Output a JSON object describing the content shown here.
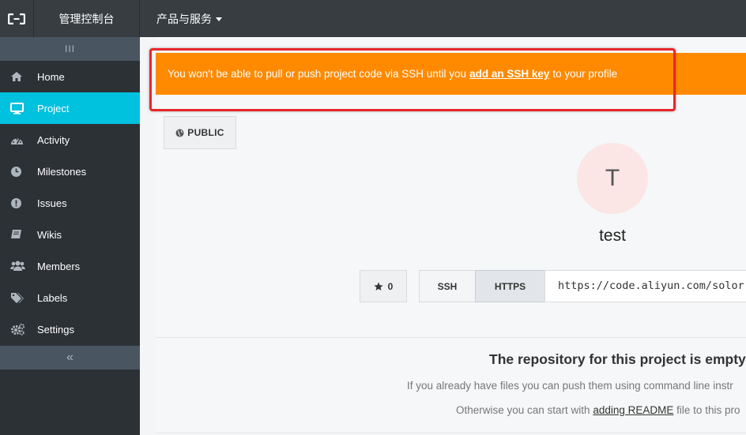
{
  "topbar": {
    "logo_icon": "aliyun-logo-icon",
    "console_label": "管理控制台",
    "products_label": "产品与服务"
  },
  "sidebar": {
    "toggle_label": "III",
    "items": [
      {
        "label": "Home",
        "icon": "home-icon"
      },
      {
        "label": "Project",
        "icon": "desktop-icon",
        "active": true
      },
      {
        "label": "Activity",
        "icon": "dashboard-icon"
      },
      {
        "label": "Milestones",
        "icon": "clock-icon"
      },
      {
        "label": "Issues",
        "icon": "exclamation-circle-icon"
      },
      {
        "label": "Wikis",
        "icon": "book-icon"
      },
      {
        "label": "Members",
        "icon": "users-icon"
      },
      {
        "label": "Labels",
        "icon": "tags-icon"
      },
      {
        "label": "Settings",
        "icon": "cogs-icon"
      }
    ],
    "collapse_label": "«"
  },
  "alert": {
    "text_before": "You won't be able to pull or push project code via SSH until you",
    "link_text": "add an SSH key",
    "text_after": "to your profile",
    "color": "#ff8a00"
  },
  "project": {
    "visibility_label": "PUBLIC",
    "avatar_letter": "T",
    "name": "test",
    "star_count": "0"
  },
  "clone": {
    "ssh_label": "SSH",
    "https_label": "HTTPS",
    "selected": "HTTPS",
    "url": "https://code.aliyun.com/solor"
  },
  "empty_repo": {
    "title": "The repository for this project is empty",
    "line1": "If you already have files you can push them using command line instr",
    "line2_before": "Otherwise you can start with",
    "line2_link": "adding README",
    "line2_after": "file to this pro"
  },
  "colors": {
    "topbar": "#373d41",
    "sidebar": "#2c3136",
    "active": "#00c1de",
    "highlight_border": "#e8262a"
  }
}
